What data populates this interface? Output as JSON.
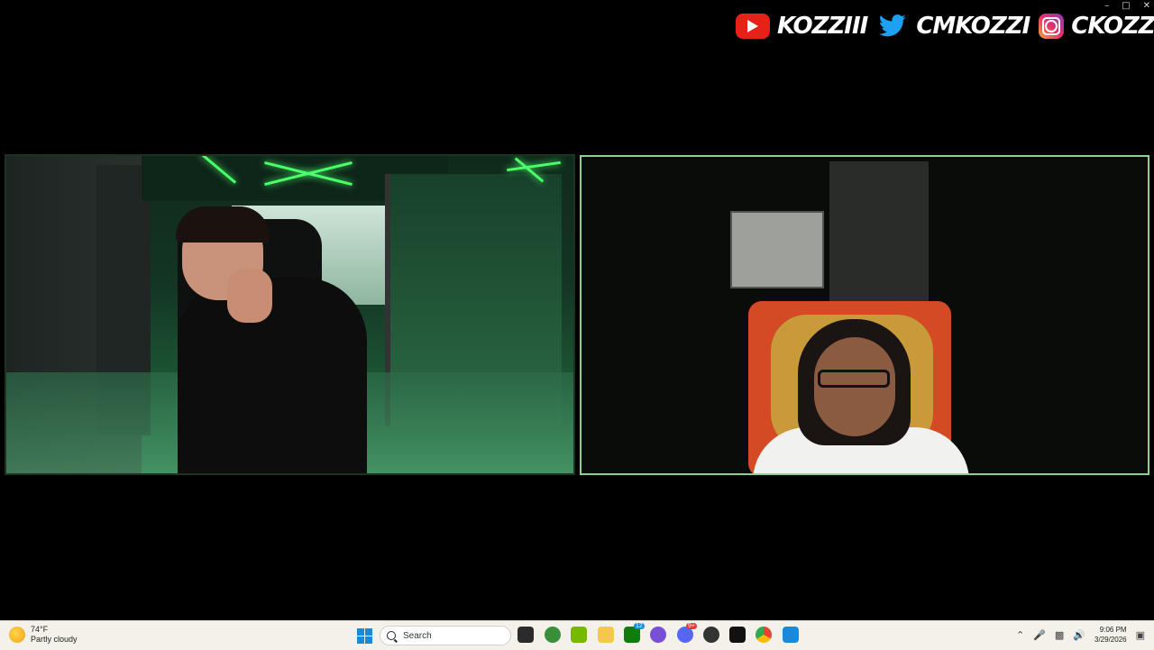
{
  "window": {
    "minimize_glyph": "–",
    "maximize_glyph": "□",
    "close_glyph": "✕"
  },
  "socials": [
    {
      "platform": "youtube-icon",
      "handle": "KOZZIII"
    },
    {
      "platform": "twitter-icon",
      "handle": "CMKOZZI"
    },
    {
      "platform": "instagram-icon",
      "handle": "CKOZZI"
    }
  ],
  "taskbar": {
    "weather": {
      "temp": "74°F",
      "condition": "Partly cloudy"
    },
    "search_placeholder": "Search",
    "apps": [
      "file-explorer-icon",
      "xbox-icon",
      "nvidia-icon",
      "folder-icon",
      "xbox-game-bar-icon",
      "media-app-icon",
      "discord-icon",
      "obs-icon",
      "epic-games-icon",
      "chrome-icon",
      "photos-icon"
    ],
    "badges": {
      "xbox_game_bar": "12",
      "discord": "9+"
    },
    "clock": {
      "time": "9:06 PM",
      "date": "3/29/2026"
    }
  },
  "colors": {
    "neon_green": "#4bff6b",
    "active_border": "#8fcf92",
    "youtube_red": "#e62117",
    "twitter_blue": "#1da1f2",
    "windows_blue": "#1a8ad8"
  }
}
